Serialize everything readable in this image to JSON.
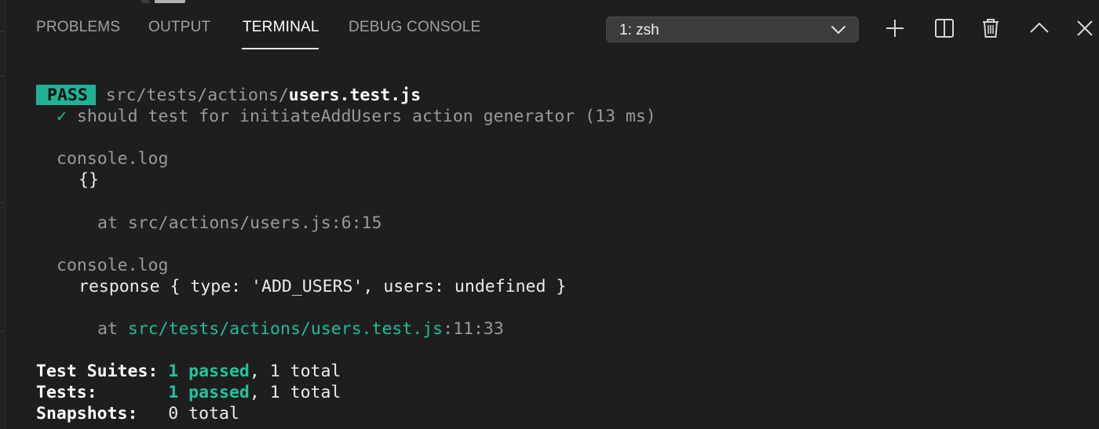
{
  "panel_tabs": [
    {
      "label": "PROBLEMS",
      "active": false
    },
    {
      "label": "OUTPUT",
      "active": false
    },
    {
      "label": "TERMINAL",
      "active": true
    },
    {
      "label": "DEBUG CONSOLE",
      "active": false
    }
  ],
  "terminal_selector": {
    "selected": "1: zsh"
  },
  "actions": [
    {
      "name": "new-terminal",
      "icon": "plus-icon"
    },
    {
      "name": "split-terminal",
      "icon": "split-icon"
    },
    {
      "name": "kill-terminal",
      "icon": "trash-icon"
    },
    {
      "name": "maximize-panel",
      "icon": "chevron-up-icon"
    },
    {
      "name": "close-panel",
      "icon": "close-icon"
    }
  ],
  "output": {
    "pass_badge": "PASS",
    "test_path_dir": "src/tests/actions/",
    "test_path_file": "users.test.js",
    "test_result_check": "✓",
    "test_result_text": "should test for initiateAddUsers action generator (13 ms)",
    "log1_header": "console.log",
    "log1_value": "{}",
    "log1_location": "at src/actions/users.js:6:15",
    "log2_header": "console.log",
    "log2_value": "response { type: 'ADD_USERS', users: undefined }",
    "log2_at": "at ",
    "log2_path": "src/tests/actions/users.test.js",
    "log2_pos": ":11:33",
    "summary": {
      "suites_label": "Test Suites:",
      "suites_passed": "1 passed",
      "suites_total": ", 1 total",
      "tests_label": "Tests:",
      "tests_passed": "1 passed",
      "tests_total": ", 1 total",
      "snapshots_label": "Snapshots:",
      "snapshots_value": "0 total"
    }
  },
  "colors": {
    "background": "#1e1e1e",
    "pass_badge": "#1fb394",
    "accent_green": "#1fbf9a",
    "selector_bg": "#3c3c3c"
  }
}
